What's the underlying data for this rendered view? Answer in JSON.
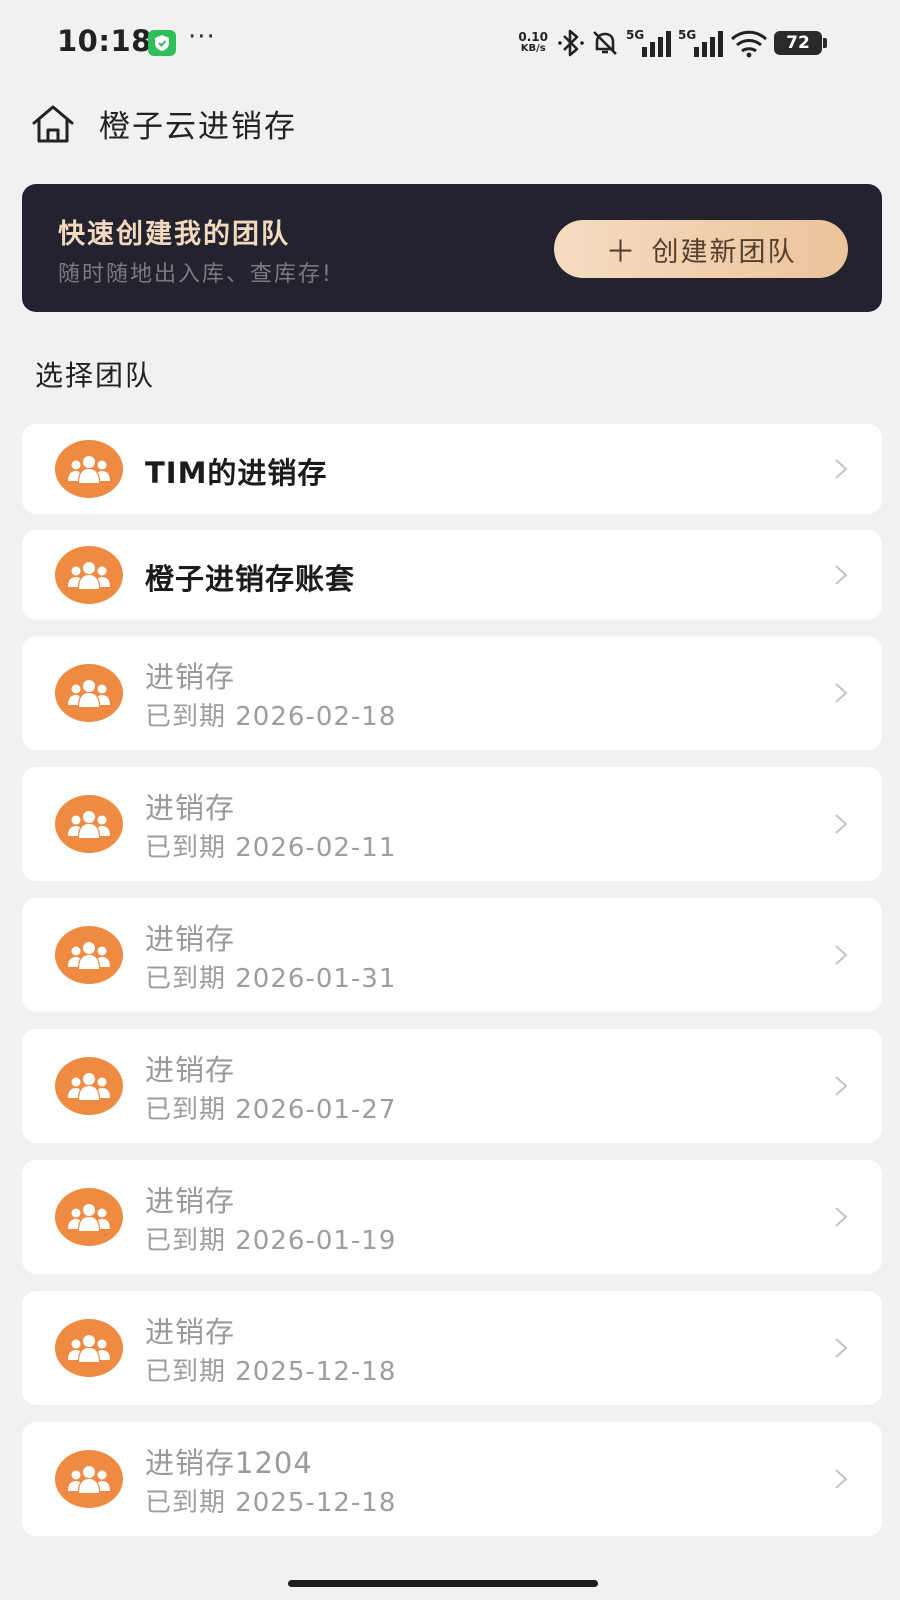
{
  "status_bar": {
    "time": "10:18",
    "dots": "···",
    "net_speed_value": "0.10",
    "net_speed_unit": "KB/s",
    "signal_1": "5G",
    "signal_2": "5G",
    "battery": "72"
  },
  "header": {
    "title": "橙子云进销存"
  },
  "banner": {
    "title": "快速创建我的团队",
    "subtitle": "随时随地出入库、查库存!",
    "button_label": "创建新团队"
  },
  "section_title": "选择团队",
  "teams": [
    {
      "name": "TIM的进销存",
      "status": "active",
      "date": ""
    },
    {
      "name": "橙子进销存账套",
      "status": "active",
      "date": ""
    },
    {
      "name": "进销存",
      "status": "expired",
      "date": "已到期 2026-02-18"
    },
    {
      "name": "进销存",
      "status": "expired",
      "date": "已到期 2026-02-11"
    },
    {
      "name": "进销存",
      "status": "expired",
      "date": "已到期 2026-01-31"
    },
    {
      "name": "进销存",
      "status": "expired",
      "date": "已到期 2026-01-27"
    },
    {
      "name": "进销存",
      "status": "expired",
      "date": "已到期 2026-01-19"
    },
    {
      "name": "进销存",
      "status": "expired",
      "date": "已到期 2025-12-18"
    },
    {
      "name": "进销存1204",
      "status": "expired",
      "date": "已到期 2025-12-18"
    }
  ],
  "colors": {
    "accent": "#ef8a42",
    "banner_bg": "#22232f",
    "button_gradient_start": "#f6dcc1",
    "button_gradient_end": "#ecc39c"
  },
  "icons": {
    "home": "home-icon",
    "team": "team-icon",
    "chevron": "chevron-right-icon",
    "plus": "plus-icon"
  }
}
